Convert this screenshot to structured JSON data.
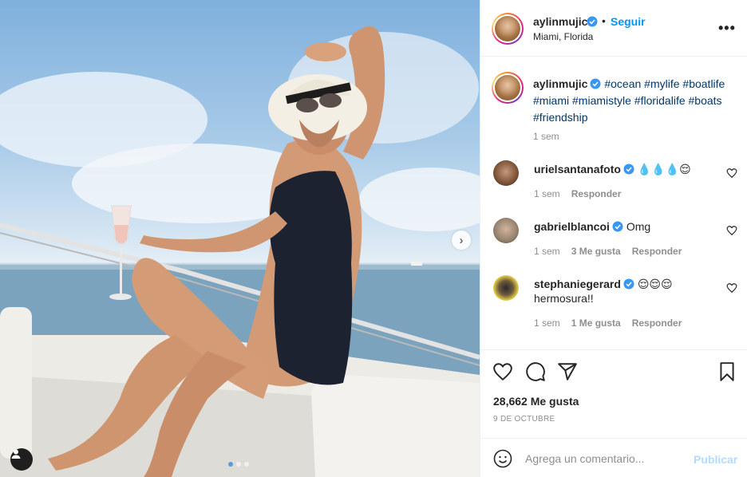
{
  "post": {
    "username": "aylinmujic",
    "verified": true,
    "follow_label": "Seguir",
    "bullet": "•",
    "location": "Miami, Florida",
    "more_label": "•••",
    "caption_hashtags": "#ocean #mylife #boatlife #miami #miamistyle #floridalife #boats #friendship",
    "caption_time": "1 sem",
    "likes": "28,662 Me gusta",
    "date": "9 DE OCTUBRE",
    "carousel": {
      "total": 3,
      "active": 1
    }
  },
  "comments": [
    {
      "username": "urielsantanafoto",
      "text": "💧💧💧😌",
      "time": "1 sem",
      "likes": "",
      "reply_label": "Responder",
      "avatar_color": "#6b4a36"
    },
    {
      "username": "gabrielblancoi",
      "text": "Omg",
      "time": "1 sem",
      "likes": "3 Me gusta",
      "reply_label": "Responder",
      "avatar_color": "#9a8672"
    },
    {
      "username": "stephaniegerard",
      "text": "😌😌😌",
      "text2": "hermosura!!",
      "time": "1 sem",
      "likes": "1 Me gusta",
      "reply_label": "Responder",
      "avatar_color": "#e8d24a"
    }
  ],
  "comment_input": {
    "placeholder": "Agrega un comentario...",
    "publish_label": "Publicar"
  },
  "colors": {
    "accent": "#0095f6",
    "verified": "#3897f0",
    "hashtag": "#00376b",
    "muted": "#8e8e8e",
    "publish_disabled": "#b3dbff"
  },
  "icons": [
    "heart-icon",
    "comment-icon",
    "share-icon",
    "bookmark-icon",
    "emoji-icon",
    "verified-icon",
    "more-icon",
    "chevron-right-icon",
    "user-tag-icon"
  ]
}
